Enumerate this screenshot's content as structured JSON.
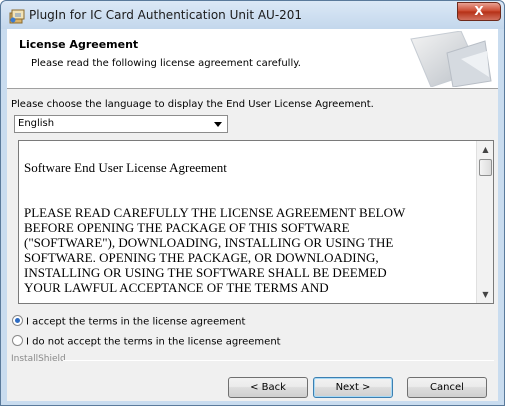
{
  "window": {
    "title": "PlugIn for IC Card Authentication Unit AU-201",
    "close_label": "X"
  },
  "header": {
    "title": "License Agreement",
    "subtitle": "Please read the following license agreement carefully."
  },
  "language": {
    "prompt": "Please choose the language to display the End User License Agreement.",
    "selected": "English"
  },
  "license": {
    "title": "Software End User License Agreement",
    "lines": [
      "PLEASE READ CAREFULLY THE LICENSE AGREEMENT BELOW",
      "BEFORE OPENING THE PACKAGE OF THIS SOFTWARE",
      "(\"SOFTWARE\"), DOWNLOADING, INSTALLING OR USING THE",
      "SOFTWARE. OPENING THE PACKAGE, OR DOWNLOADING,",
      "INSTALLING OR USING THE SOFTWARE SHALL BE DEEMED",
      "YOUR LAWFUL ACCEPTANCE OF THE TERMS AND"
    ]
  },
  "options": {
    "accept": "I accept the terms in the license agreement",
    "decline": "I do not accept the terms in the license agreement",
    "selected": "accept"
  },
  "footer": {
    "brand": "InstallShield",
    "back": "< Back",
    "next": "Next >",
    "cancel": "Cancel"
  },
  "colors": {
    "accent": "#2d6bc2",
    "close": "#c9452b"
  }
}
